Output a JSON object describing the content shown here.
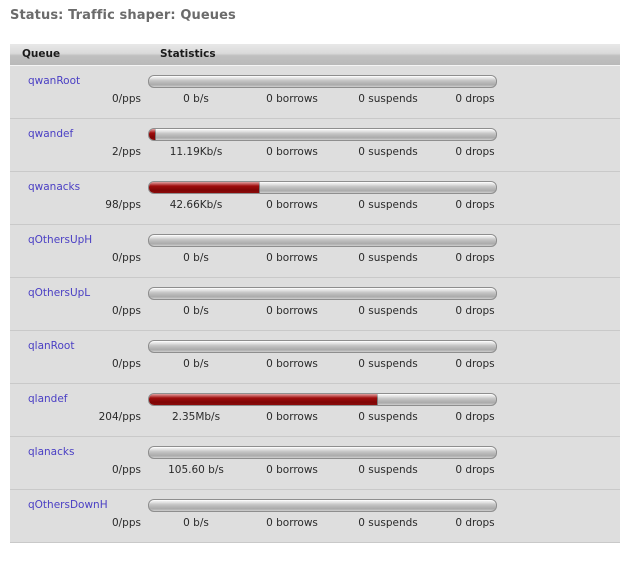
{
  "page_title": "Status: Traffic shaper: Queues",
  "table": {
    "columns": [
      "Queue",
      "Statistics"
    ],
    "rows": [
      {
        "queue": "qwanRoot",
        "pps": "0/pps",
        "rate": "0 b/s",
        "borrows": "0 borrows",
        "suspends": "0 suspends",
        "drops": "0 drops",
        "fill_percent": 0
      },
      {
        "queue": "qwandef",
        "pps": "2/pps",
        "rate": "11.19Kb/s",
        "borrows": "0 borrows",
        "suspends": "0 suspends",
        "drops": "0 drops",
        "fill_percent": 2
      },
      {
        "queue": "qwanacks",
        "pps": "98/pps",
        "rate": "42.66Kb/s",
        "borrows": "0 borrows",
        "suspends": "0 suspends",
        "drops": "0 drops",
        "fill_percent": 32
      },
      {
        "queue": "qOthersUpH",
        "pps": "0/pps",
        "rate": "0 b/s",
        "borrows": "0 borrows",
        "suspends": "0 suspends",
        "drops": "0 drops",
        "fill_percent": 0
      },
      {
        "queue": "qOthersUpL",
        "pps": "0/pps",
        "rate": "0 b/s",
        "borrows": "0 borrows",
        "suspends": "0 suspends",
        "drops": "0 drops",
        "fill_percent": 0
      },
      {
        "queue": "qlanRoot",
        "pps": "0/pps",
        "rate": "0 b/s",
        "borrows": "0 borrows",
        "suspends": "0 suspends",
        "drops": "0 drops",
        "fill_percent": 0
      },
      {
        "queue": "qlandef",
        "pps": "204/pps",
        "rate": "2.35Mb/s",
        "borrows": "0 borrows",
        "suspends": "0 suspends",
        "drops": "0 drops",
        "fill_percent": 66
      },
      {
        "queue": "qlanacks",
        "pps": "0/pps",
        "rate": "105.60 b/s",
        "borrows": "0 borrows",
        "suspends": "0 suspends",
        "drops": "0 drops",
        "fill_percent": 0
      },
      {
        "queue": "qOthersDownH",
        "pps": "0/pps",
        "rate": "0 b/s",
        "borrows": "0 borrows",
        "suspends": "0 suspends",
        "drops": "0 drops",
        "fill_percent": 0
      }
    ]
  },
  "colors": {
    "page_background": "#ffffff",
    "table_background": "#dedede",
    "header_gradient_top": "#e8e8e8",
    "header_gradient_bottom": "#b9b9b9",
    "title_text": "#6b6b6b",
    "queue_link": "#4a3fc4",
    "value_text": "#2a2a2a",
    "bar_fill": "#a00d0d",
    "bar_track": "#bdbdbd",
    "bar_border": "#8e8e8e"
  }
}
